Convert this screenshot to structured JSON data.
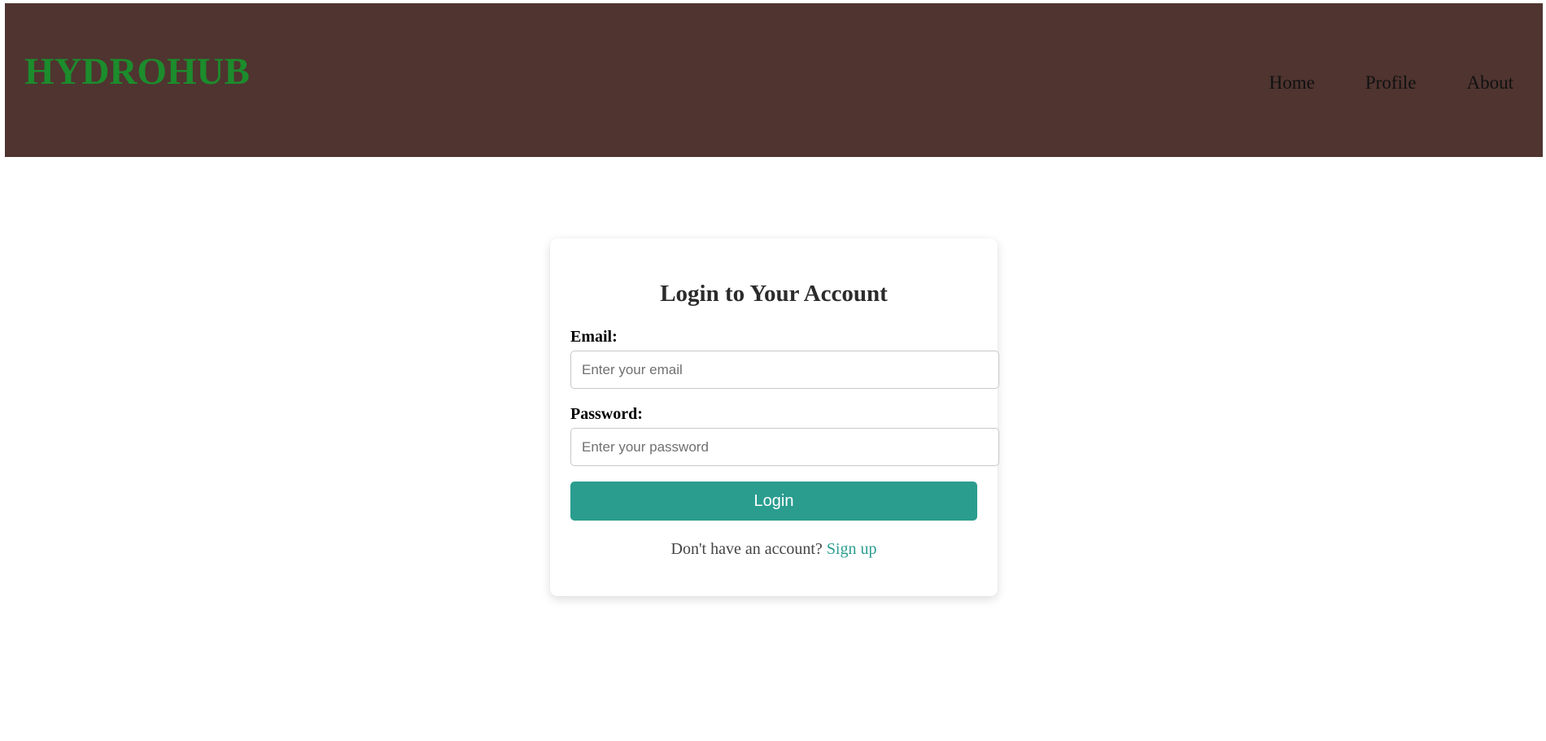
{
  "header": {
    "brand": "HYDROHUB",
    "nav": [
      {
        "label": "Home"
      },
      {
        "label": "Profile"
      },
      {
        "label": "About"
      }
    ]
  },
  "login_form": {
    "title": "Login to Your Account",
    "email_label": "Email:",
    "email_placeholder": "Enter your email",
    "email_value": "",
    "password_label": "Password:",
    "password_placeholder": "Enter your password",
    "password_value": "",
    "submit_label": "Login",
    "signup_prompt": "Don't have an account?",
    "signup_link": "Sign up"
  },
  "colors": {
    "header_bg": "#4f3430",
    "brand": "#1c8c2c",
    "accent": "#2a9d8f"
  }
}
